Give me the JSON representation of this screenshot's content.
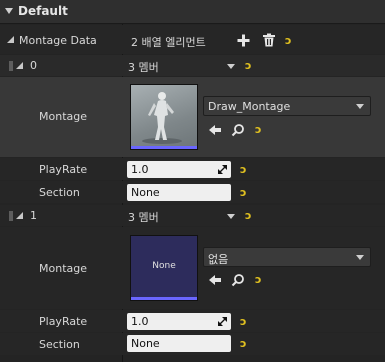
{
  "category": {
    "title": "Default"
  },
  "array": {
    "label": "Montage Data",
    "summary": "2 배열 엘리먼트",
    "add_icon": "plus-icon",
    "delete_icon": "trash-icon",
    "reset_icon": "reset-arrow-icon"
  },
  "elements": [
    {
      "index": "0",
      "summary": "3 멤버",
      "montage": {
        "label": "Montage",
        "asset": "Draw_Montage",
        "thumbnail": "character-mannequin"
      },
      "playrate": {
        "label": "PlayRate",
        "value": "1.0"
      },
      "section": {
        "label": "Section",
        "value": "None"
      }
    },
    {
      "index": "1",
      "summary": "3 멤버",
      "montage": {
        "label": "Montage",
        "asset": "없음",
        "thumbnail_text": "None"
      },
      "playrate": {
        "label": "PlayRate",
        "value": "1.0"
      },
      "section": {
        "label": "Section",
        "value": "None"
      }
    }
  ],
  "colors": {
    "background": "#242424",
    "row_highlight": "#2d2d2d",
    "reset_icon": "#e0c020",
    "thumbnail_bar": "#6a66ff",
    "none_thumbnail": "#2d2c5c"
  }
}
